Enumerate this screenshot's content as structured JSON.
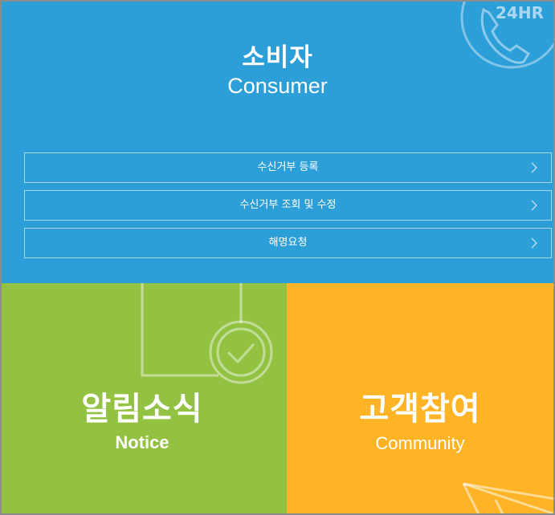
{
  "consumer": {
    "title": "소비자",
    "subtitle": "Consumer",
    "badge": "24HR",
    "menu": [
      {
        "label": "수신거부 등록"
      },
      {
        "label": "수신거부 조회 및 수정"
      },
      {
        "label": "해명요청"
      }
    ]
  },
  "notice": {
    "title": "알림소식",
    "subtitle": "Notice"
  },
  "community": {
    "title": "고객참여",
    "subtitle": "Community"
  },
  "colors": {
    "consumer_bg": "#2c9fd9",
    "notice_bg": "#93c243",
    "community_bg": "#ffb426",
    "text": "#ffffff"
  },
  "icons": {
    "phone": "phone-24hr-icon",
    "chevron": "chevron-right-icon",
    "check": "check-circle-icon",
    "plane": "paper-plane-icon"
  }
}
